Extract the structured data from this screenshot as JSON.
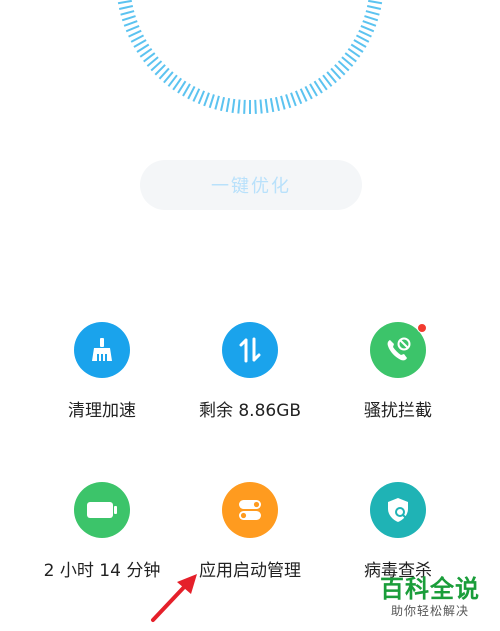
{
  "colors": {
    "gauge_ticks": "#5cc3f0",
    "optimize_text": "#b9e1fb",
    "blue": "#1aa3ec",
    "green": "#3cc46a",
    "orange": "#ff9b1f",
    "teal": "#1fb3b5",
    "badge": "#f23b2f",
    "arrow": "#e5202a"
  },
  "optimize_button": {
    "label": "一键优化"
  },
  "tools": [
    {
      "label": "清理加速",
      "icon": "broom-icon",
      "color": "#1aa3ec"
    },
    {
      "label": "剩余 8.86GB",
      "icon": "up-down-arrows-icon",
      "color": "#1aa3ec"
    },
    {
      "label": "骚扰拦截",
      "icon": "phone-block-icon",
      "color": "#3cc46a",
      "badge": true
    },
    {
      "label": "2 小时 14 分钟",
      "icon": "battery-icon",
      "color": "#3cc46a"
    },
    {
      "label": "应用启动管理",
      "icon": "toggle-switches-icon",
      "color": "#ff9b1f"
    },
    {
      "label": "病毒查杀",
      "icon": "shield-search-icon",
      "color": "#1fb3b5"
    }
  ],
  "watermark": {
    "title": "百科全说",
    "subtitle": "助你轻松解决"
  }
}
